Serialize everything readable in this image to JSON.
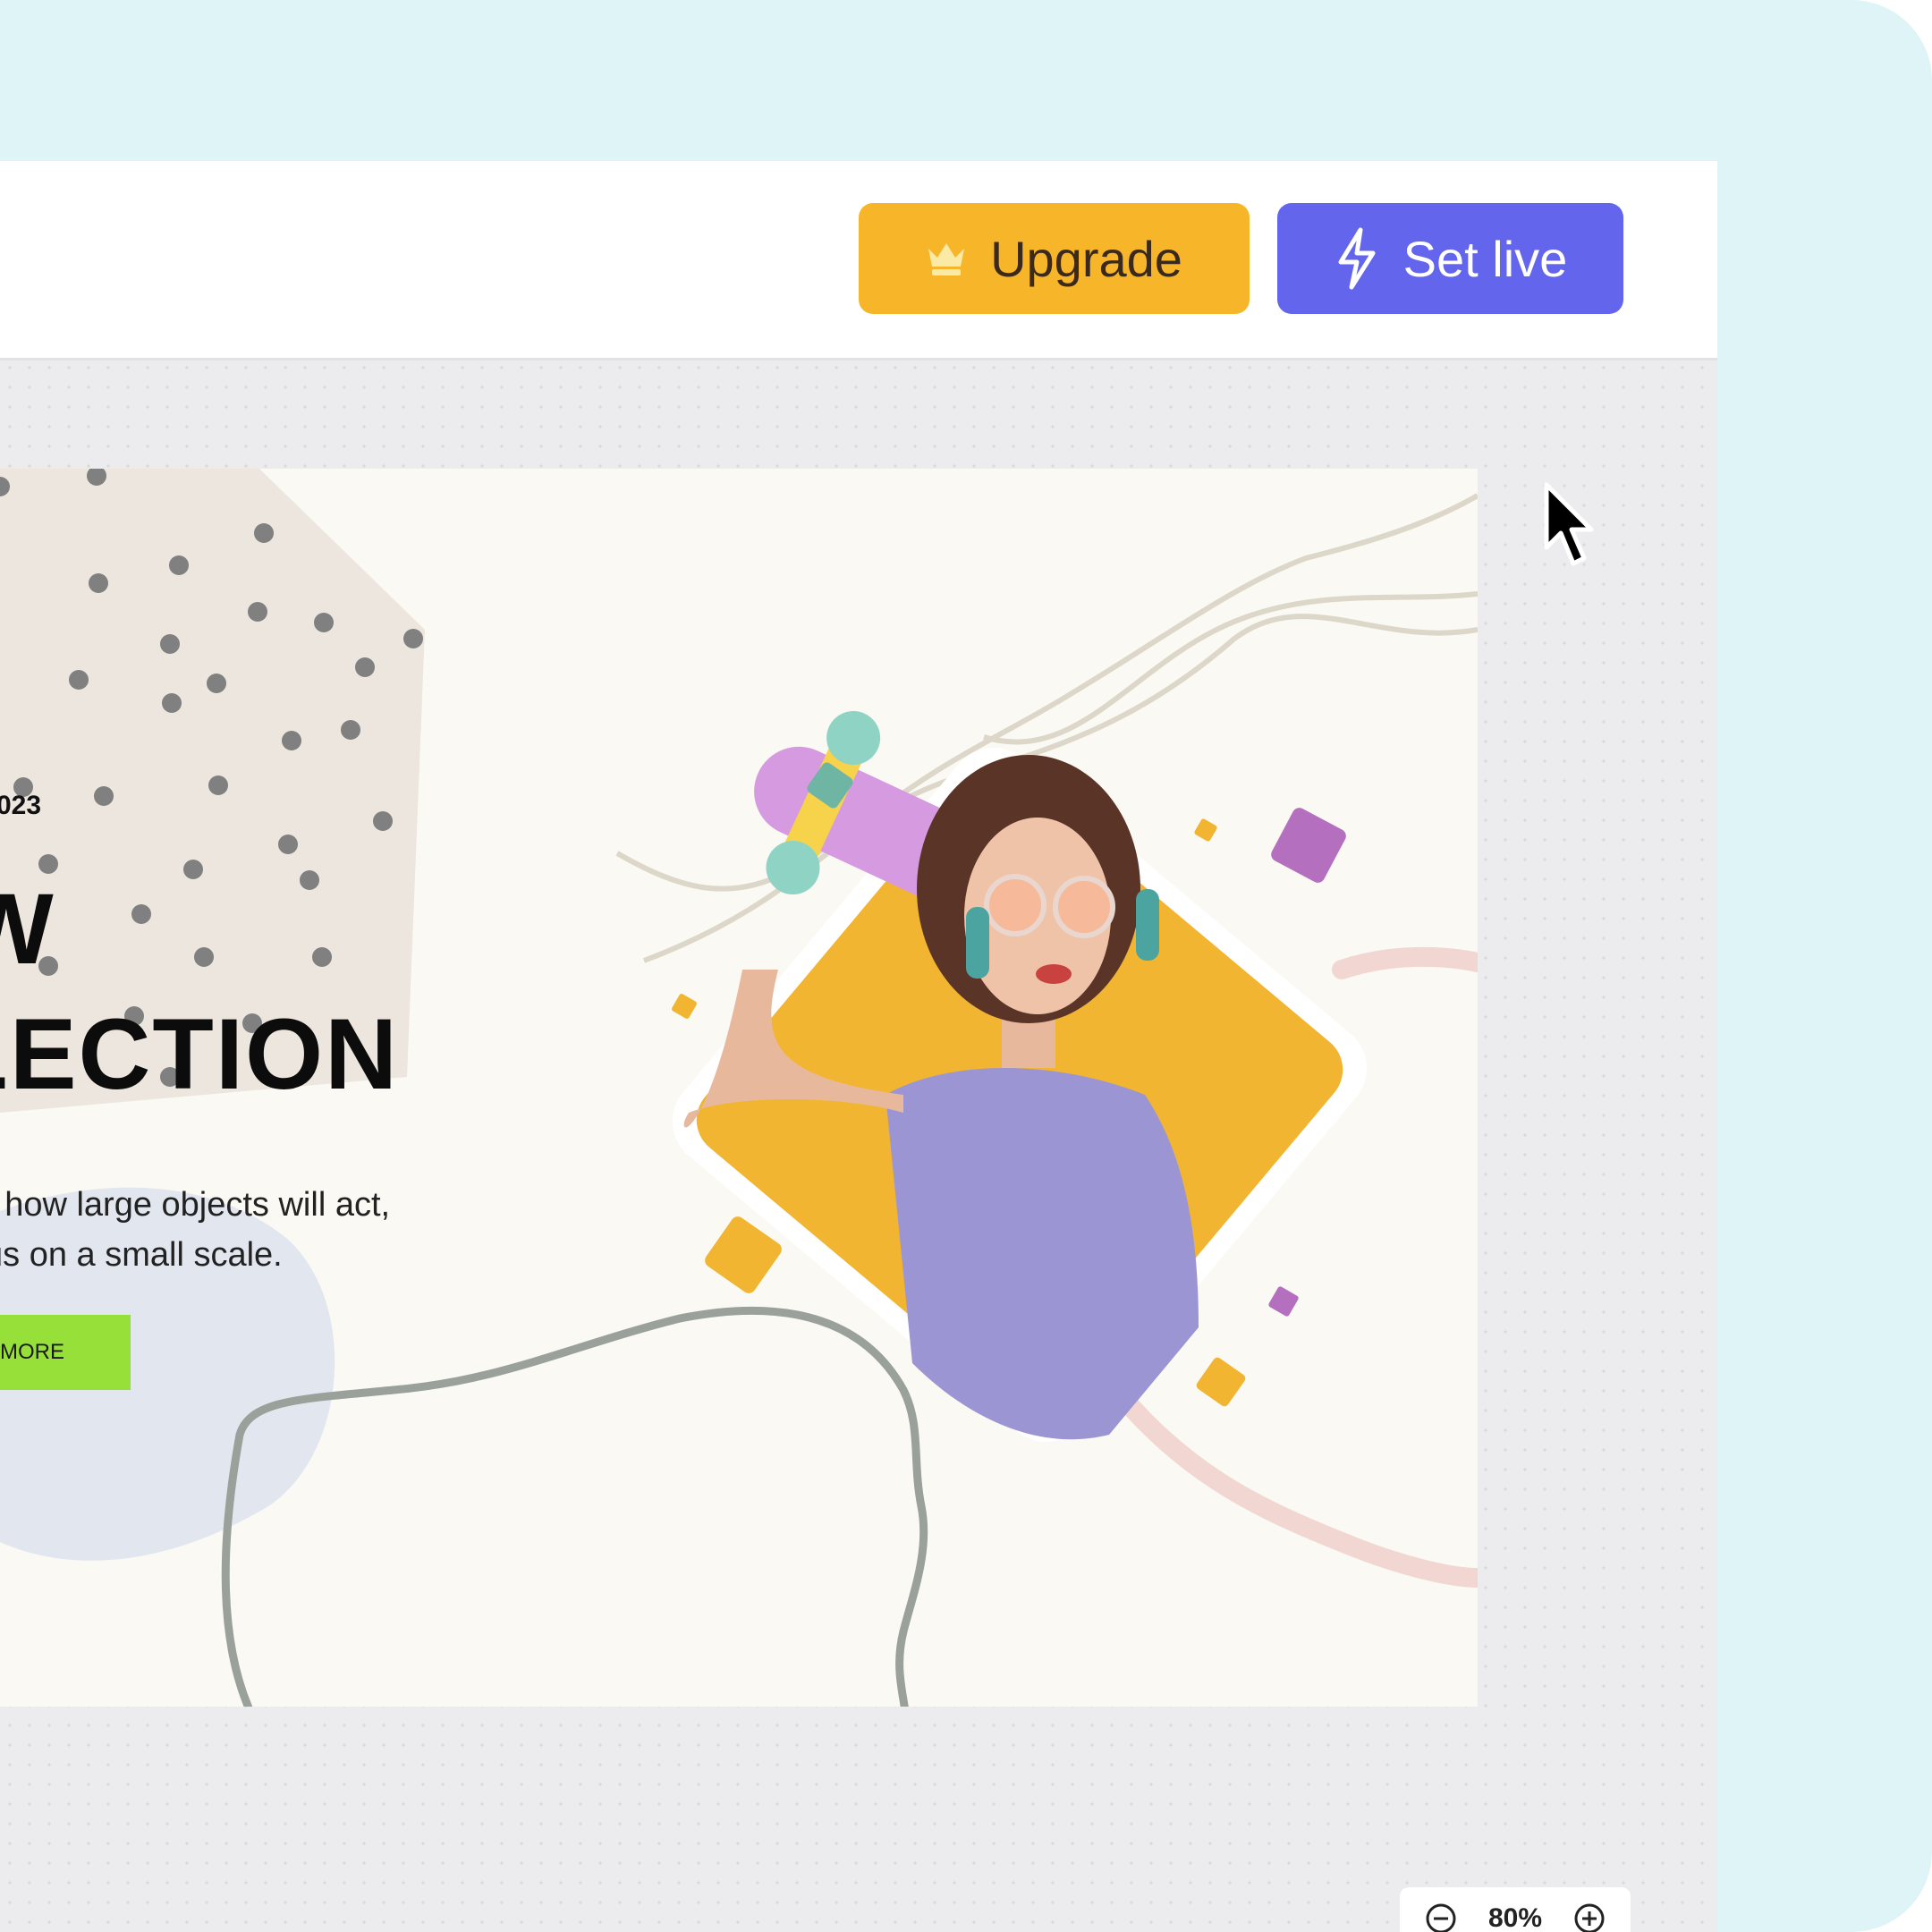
{
  "toolbar": {
    "upgrade_label": "Upgrade",
    "upgrade_icon": "crown-icon",
    "set_live_label": "Set live",
    "set_live_icon": "lightning-icon"
  },
  "canvas": {
    "year_text": "023",
    "headline_line1": "W",
    "headline_line2": "LLECTION",
    "body_line1": "r how large objects will act,",
    "body_line2": "us on a small scale.",
    "cta_label": "MORE"
  },
  "zoom": {
    "level": "80%",
    "zoom_out_icon": "minus-circle-icon",
    "zoom_in_icon": "plus-circle-icon"
  },
  "colors": {
    "frame_bg": "#def4f6",
    "upgrade_bg": "#f7b529",
    "set_live_bg": "#6366ec",
    "cta_bg": "#97e03a",
    "accent_yellow": "#f2b531",
    "accent_purple": "#b46fbe",
    "accent_teal": "#6fb5a4"
  }
}
